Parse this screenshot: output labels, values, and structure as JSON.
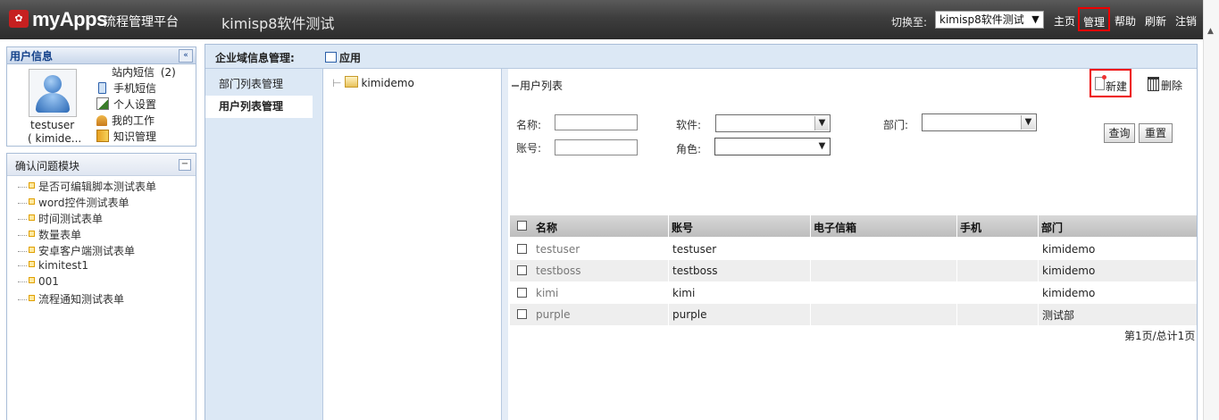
{
  "header": {
    "logo_icon": "myapps-logo-icon",
    "logo_text": "myApps",
    "logo_subtitle": "流程管理平台",
    "app_title": "kimisp8软件测试",
    "switch_label": "切换至:",
    "app_select_value": "kimisp8软件测试",
    "nav": {
      "home": "主页",
      "manage": "管理",
      "help": "帮助",
      "refresh": "刷新",
      "logout": "注销"
    }
  },
  "user_panel": {
    "title": "用户信息",
    "collapse": "«",
    "user_name": "testuser",
    "user_id": "( kimide...",
    "menu": [
      {
        "label": "站内短信",
        "count": "(2)",
        "icon": "none"
      },
      {
        "label": "手机短信",
        "icon": "mobile-icon"
      },
      {
        "label": "个人设置",
        "icon": "edit-icon"
      },
      {
        "label": "我的工作",
        "icon": "work-icon"
      },
      {
        "label": "知识管理",
        "icon": "knowledge-icon"
      }
    ]
  },
  "module_panel": {
    "title": "确认问题模块",
    "collapse": "−",
    "items": [
      "是否可编辑脚本测试表单",
      "word控件测试表单",
      "时间测试表单",
      "数量表单",
      "安卓客户端测试表单",
      "kimitest1",
      "001",
      "流程通知测试表单"
    ]
  },
  "main": {
    "title": "企业域信息管理:",
    "app_tab": "应用",
    "sub_nav": [
      "部门列表管理",
      "用户列表管理"
    ],
    "tree_root": "kimidemo",
    "list_title": "用户列表",
    "new_label": "新建",
    "delete_label": "删除",
    "filters": {
      "name_label": "名称:",
      "software_label": "软件:",
      "dept_label": "部门:",
      "account_label": "账号:",
      "role_label": "角色:",
      "query_label": "查询",
      "reset_label": "重置"
    },
    "table": {
      "columns": [
        "名称",
        "账号",
        "电子信箱",
        "手机",
        "部门"
      ],
      "rows": [
        [
          "testuser",
          "testuser",
          "",
          "",
          "kimidemo"
        ],
        [
          "testboss",
          "testboss",
          "",
          "",
          "kimidemo"
        ],
        [
          "kimi",
          "kimi",
          "",
          "",
          "kimidemo"
        ],
        [
          "purple",
          "purple",
          "",
          "",
          "测试部"
        ]
      ]
    },
    "pager": "第1页/总计1页"
  },
  "colors": {
    "header_bg": "#3e3e3e",
    "panel_border": "#a9bdd7",
    "nav_bg": "#dce8f5",
    "highlight": "#ee0000"
  }
}
